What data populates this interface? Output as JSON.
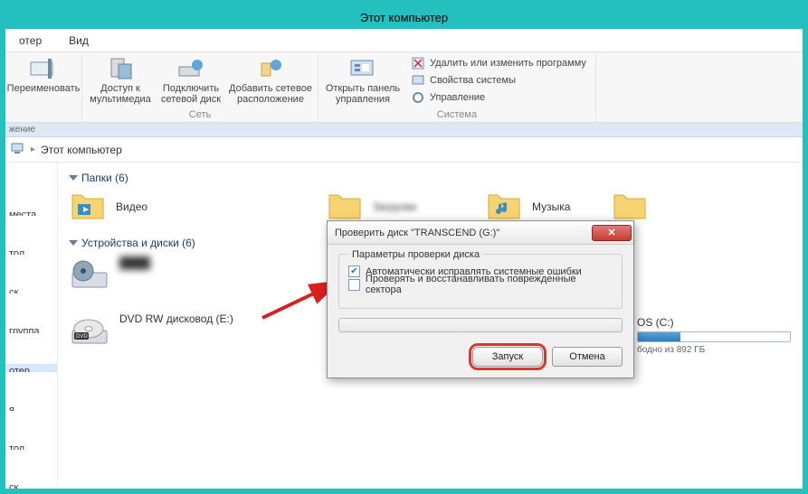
{
  "window": {
    "title": "Этот компьютер"
  },
  "tabs": {
    "computer": "отер",
    "view": "Вид"
  },
  "ribbon": {
    "rename": "Переименовать",
    "media": "Доступ к\nмультимедиа",
    "netdrive": "Подключить\nсетевой диск",
    "addnet": "Добавить сетевое\nрасположение",
    "group_net": "Сеть",
    "ctrlpanel": "Открыть панель\nуправления",
    "r1": "Удалить или изменить программу",
    "r2": "Свойства системы",
    "r3": "Управление",
    "group_sys": "Система",
    "footer": "жение"
  },
  "addr": {
    "root": "Этот компьютер"
  },
  "nav": {
    "places": "места",
    "desk": "тол",
    "disk": "ск",
    "group": "группа",
    "computer": "отер",
    "n1": "я",
    "n2": "тол",
    "n3": "ск"
  },
  "sections": {
    "folders": "Папки (6)",
    "devices": "Устройства и диски (6)"
  },
  "folders": {
    "video": "Видео",
    "downloads": "Загрузки",
    "music": "Музыка"
  },
  "drives": {
    "os_label": "OS (C:)",
    "os_free": "бодно из 892 ГБ",
    "dvd": "DVD RW дисковод (E:)"
  },
  "dialog": {
    "title": "Проверить диск \"TRANSCEND (G:)\"",
    "legend": "Параметры проверки диска",
    "opt1": "Автоматически исправлять системные ошибки",
    "opt2": "Проверять и восстанавливать поврежденные сектора",
    "start": "Запуск",
    "cancel": "Отмена"
  }
}
